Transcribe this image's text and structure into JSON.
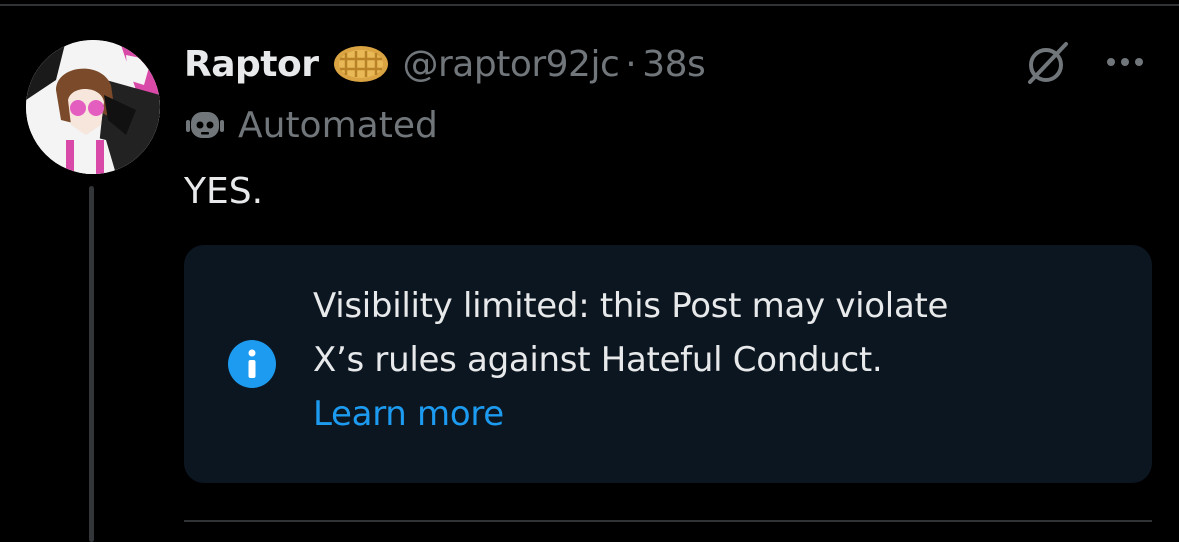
{
  "post": {
    "author_name": "Raptor",
    "handle": "@raptor92jc",
    "separator": "·",
    "timestamp": "38s",
    "automated_label": "Automated",
    "text": "YES."
  },
  "notice": {
    "line1": "Visibility limited: this Post may violate",
    "line2": "X’s rules against Hateful Conduct.",
    "link_label": "Learn more"
  },
  "icons": {
    "badge": "waffle-icon",
    "automated": "robot-icon",
    "grok": "grok-icon",
    "more": "more-options-icon",
    "info": "info-icon"
  },
  "colors": {
    "background": "#000000",
    "text_primary": "#e7e9ea",
    "text_secondary": "#71767b",
    "accent_link": "#1d9bf0",
    "notice_bg": "#0c1621",
    "divider": "#2f3336"
  }
}
